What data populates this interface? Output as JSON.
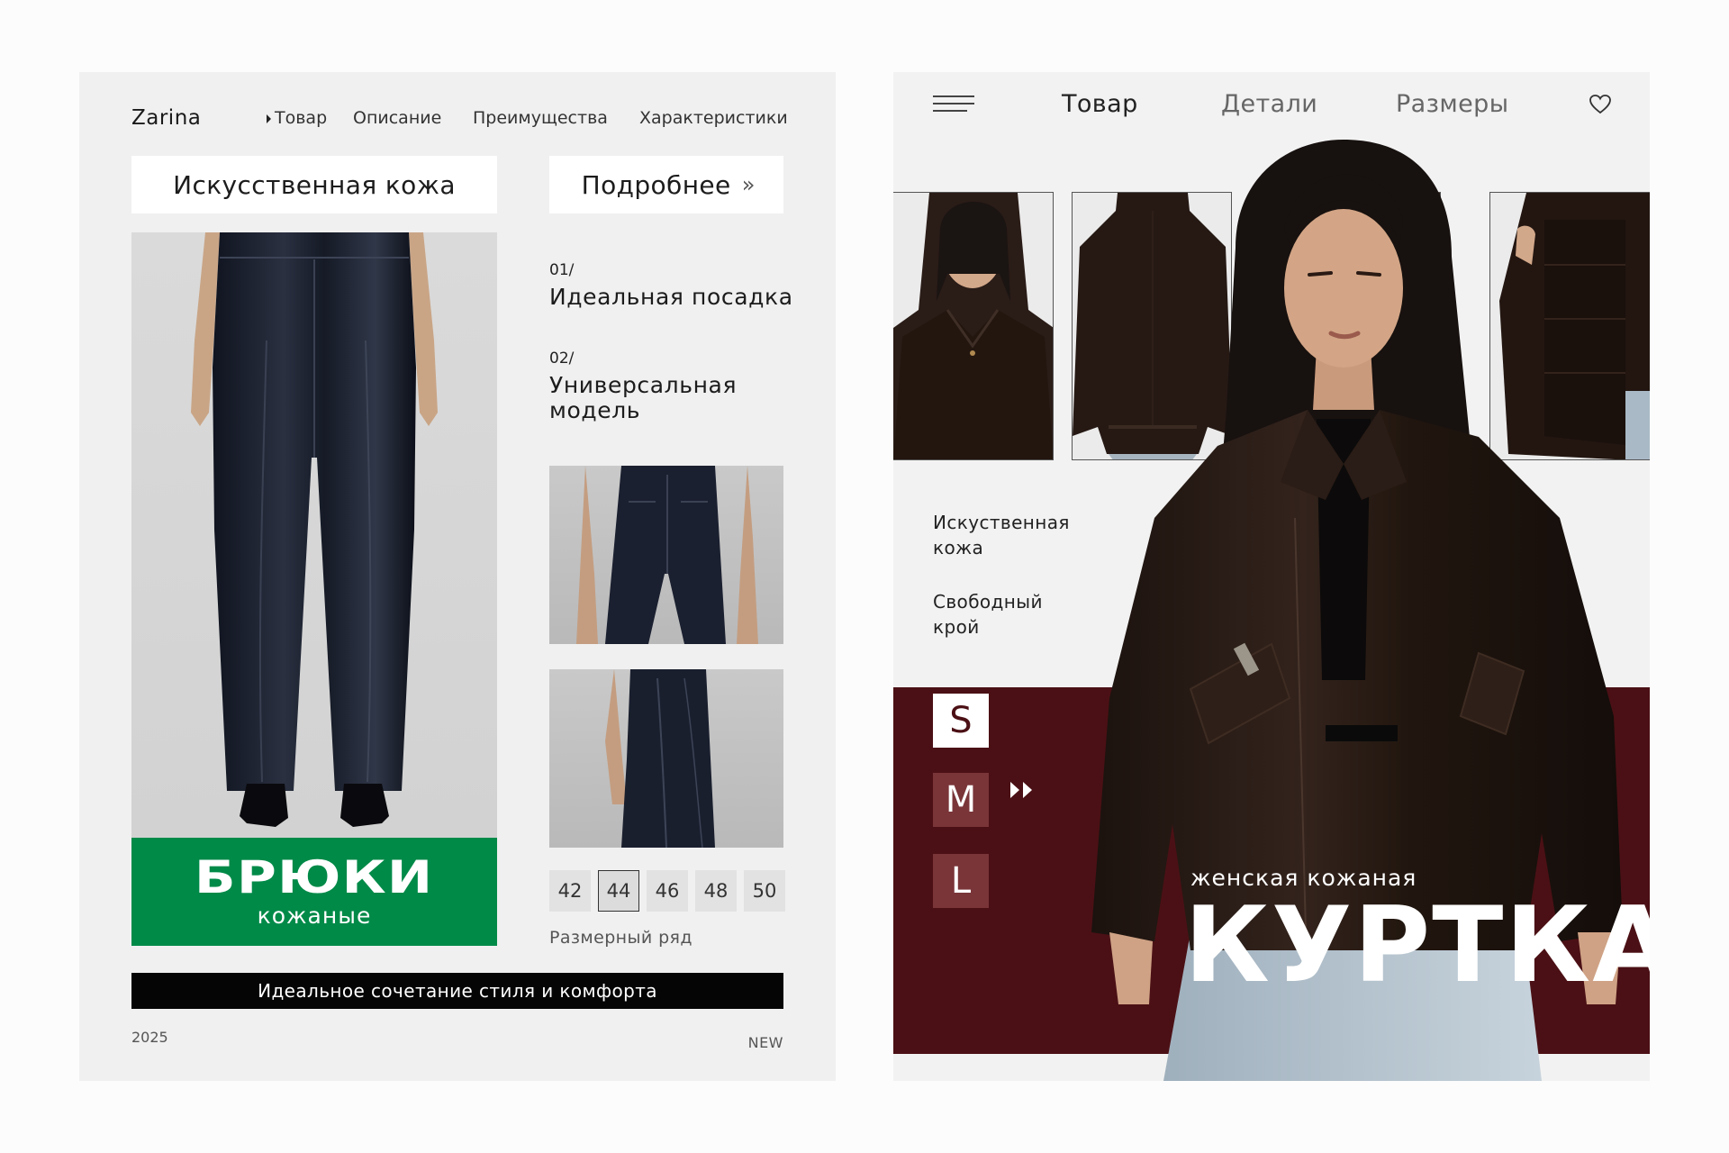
{
  "left_card": {
    "brand": "Zarina",
    "nav": [
      "Товар",
      "Описание",
      "Преимущества",
      "Характеристики"
    ],
    "material_label": "Искусственная кожа",
    "more_button": "Подробнее",
    "more_chevron": "»",
    "features": [
      {
        "num": "01/",
        "title": "Идеальная посадка"
      },
      {
        "num": "02/",
        "title_line1": "Универсальная",
        "title_line2": "модель"
      }
    ],
    "product_title": "БРЮКИ",
    "product_subtitle": "кожаные",
    "sizes": [
      "42",
      "44",
      "46",
      "48",
      "50"
    ],
    "selected_size": "44",
    "size_caption": "Размерный ряд",
    "banner": "Идеальное сочетание стиля и комфорта",
    "year": "2025",
    "badge": "NEW",
    "colors": {
      "green": "#008a48",
      "bar": "#050505",
      "bg": "#f0f0f0"
    }
  },
  "right_card": {
    "nav": [
      "Товар",
      "Детали",
      "Размеры"
    ],
    "features": [
      {
        "line1": "Искуственная",
        "line2": "кожа"
      },
      {
        "line1": "Свободный",
        "line2": "крой"
      }
    ],
    "sizes": [
      "S",
      "M",
      "L"
    ],
    "selected_size": "S",
    "subtitle": "женская кожаная",
    "title": "КУРТКА",
    "icons": [
      "menu-icon",
      "heart-icon",
      "fast-forward-icon"
    ],
    "colors": {
      "maroon": "#4b1015",
      "tile": "#7a3539",
      "bg": "#f2f2f2"
    }
  }
}
